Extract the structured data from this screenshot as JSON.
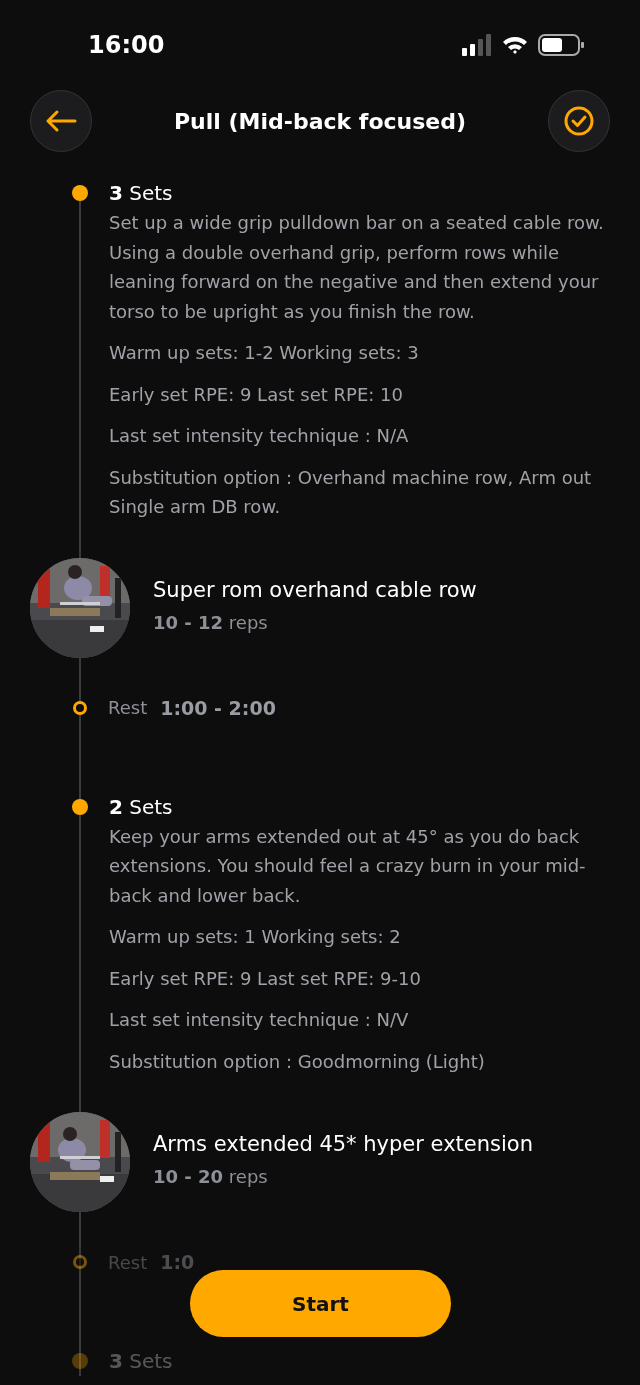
{
  "status_bar": {
    "time": "16:00"
  },
  "header": {
    "title": "Pull (Mid-back focused)"
  },
  "timeline": [
    {
      "kind": "sets",
      "count": "3",
      "label": "Sets",
      "dimmed": false,
      "notes": [
        "Set up a wide grip pulldown bar on a seated cable row. Using a double overhand grip, perform rows while leaning forward on the negative and then extend your torso to be upright as you finish the row.",
        "Warm up sets: 1-2 Working sets: 3",
        "Early set RPE: 9 Last set RPE: 10",
        "Last set intensity technique : N/A",
        "Substitution option : Overhand machine row, Arm out Single arm DB row."
      ]
    },
    {
      "kind": "exercise",
      "name": "Super rom overhand cable row",
      "reps": "10 - 12",
      "unit": "reps"
    },
    {
      "kind": "rest",
      "label": "Rest",
      "time": "1:00 - 2:00",
      "dimmed": false
    },
    {
      "kind": "sets",
      "count": "2",
      "label": "Sets",
      "dimmed": false,
      "notes": [
        "Keep your arms extended out at 45° as you do back extensions. You should feel a crazy burn in your mid-back and lower back.",
        "Warm up sets: 1 Working sets: 2",
        "Early set RPE: 9 Last set RPE: 9-10",
        "Last set intensity technique : N/V",
        "Substitution option :  Goodmorning (Light)"
      ]
    },
    {
      "kind": "exercise",
      "name": "Arms extended 45* hyper extension",
      "reps": "10 - 20",
      "unit": "reps"
    },
    {
      "kind": "rest",
      "label": "Rest",
      "time": "1:0",
      "dimmed": true
    },
    {
      "kind": "sets",
      "count": "3",
      "label": "Sets",
      "dimmed": true
    }
  ],
  "start_button": {
    "label": "Start"
  }
}
